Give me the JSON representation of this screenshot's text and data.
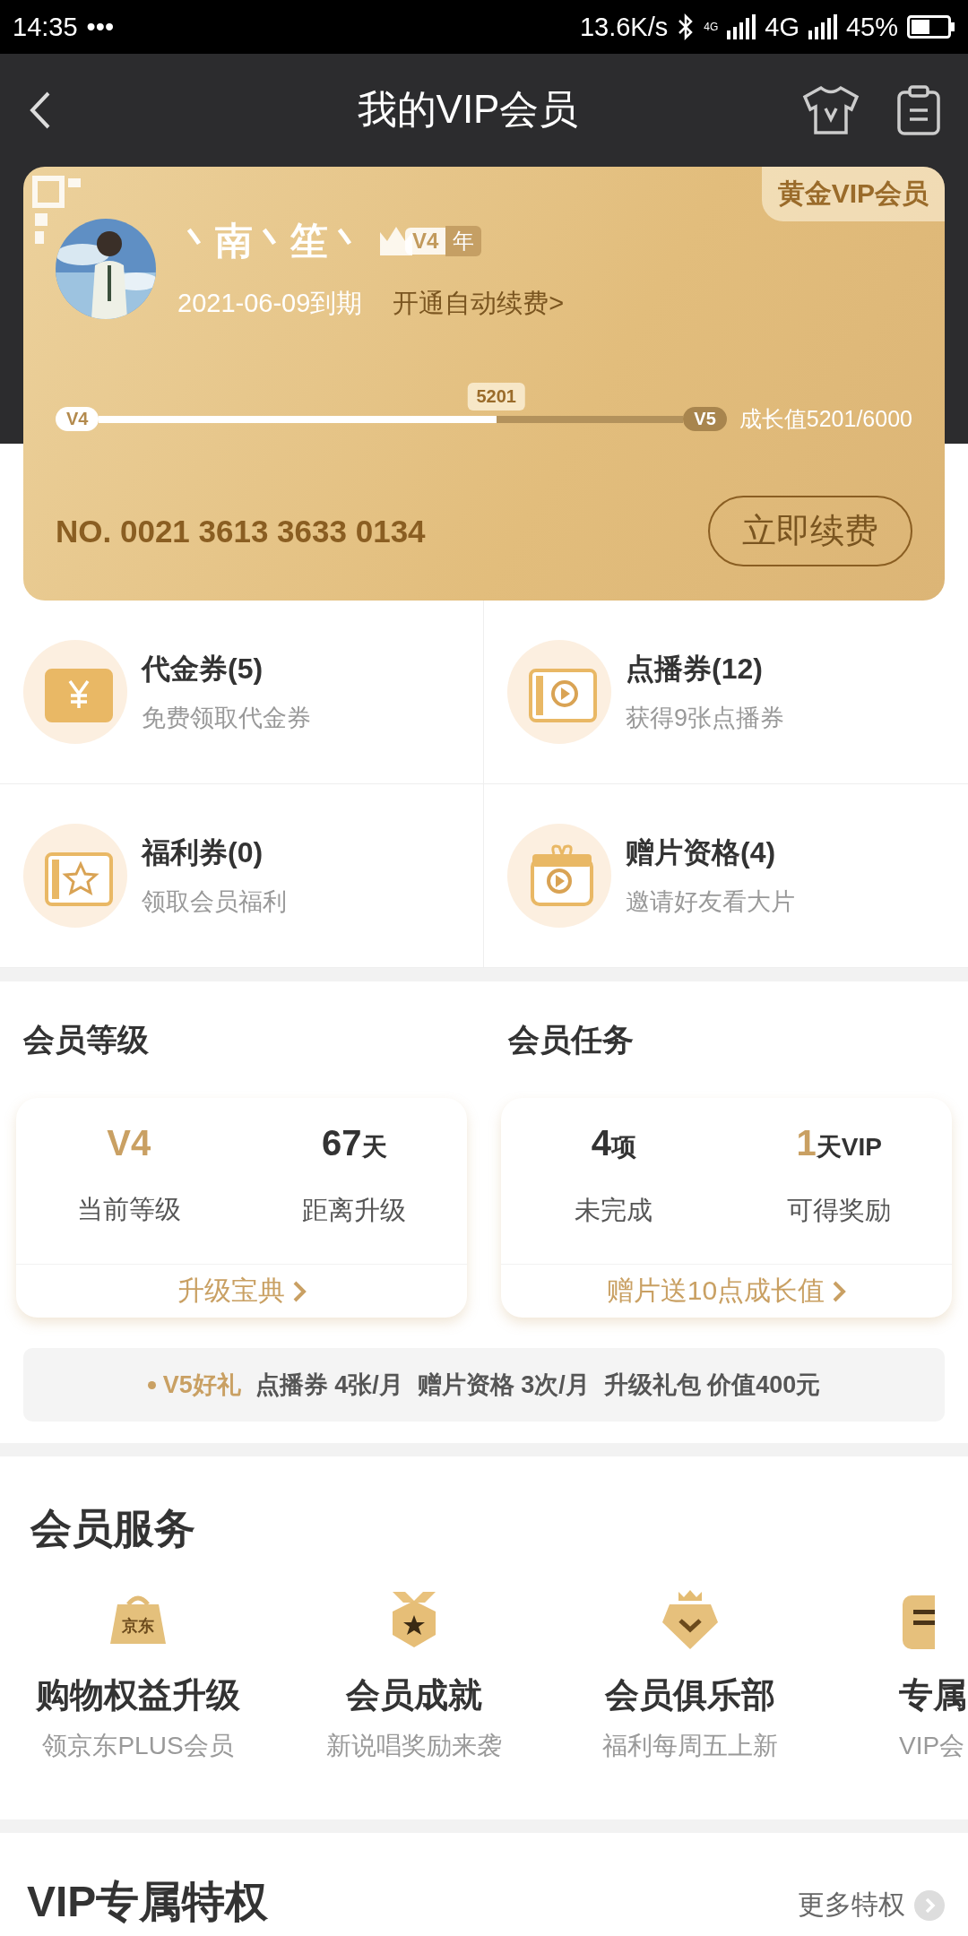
{
  "status_bar": {
    "time": "14:35",
    "dots": "•••",
    "speed": "13.6K/s",
    "network_small": "4G",
    "network": "4G",
    "battery": "45%"
  },
  "header": {
    "title": "我的VIP会员"
  },
  "card": {
    "badge": "黄金VIP会员",
    "username": "丶南丶笙丶",
    "level_tag": "V4",
    "year_tag": "年",
    "expiry": "2021-06-09到期",
    "auto_renew": "开通自动续费>",
    "progress": {
      "start": "V4",
      "end": "V5",
      "marker": "5201",
      "level": 0.68,
      "reading": "成长值5201/6000"
    },
    "number": "NO. 0021 3613 3633 0134",
    "renew_button": "立即续费"
  },
  "coupons": [
    {
      "kind": "yuan",
      "title": "代金券(5)",
      "subtitle": "免费领取代金券"
    },
    {
      "kind": "play",
      "title": "点播券(12)",
      "subtitle": "获得9张点播券"
    },
    {
      "kind": "star",
      "title": "福利券(0)",
      "subtitle": "领取会员福利"
    },
    {
      "kind": "gift",
      "title": "赠片资格(4)",
      "subtitle": "邀请好友看大片"
    }
  ],
  "panels": [
    {
      "title": "会员等级",
      "stats": [
        {
          "value": "V4",
          "highlight": true,
          "label": "当前等级"
        },
        {
          "value": "67",
          "unit": "天",
          "highlight": false,
          "label": "距离升级"
        }
      ],
      "link": "升级宝典"
    },
    {
      "title": "会员任务",
      "stats": [
        {
          "value": "4",
          "unit": "项",
          "highlight": false,
          "label": "未完成"
        },
        {
          "value": "1",
          "unit": "天VIP",
          "highlight": true,
          "label": "可得奖励"
        }
      ],
      "link": "赠片送10点成长值"
    }
  ],
  "v5_bar": {
    "title": "V5好礼",
    "items": [
      "点播券 4张/月",
      "赠片资格 3次/月",
      "升级礼包 价值400元"
    ]
  },
  "services": {
    "title": "会员服务",
    "items": [
      {
        "kind": "bag",
        "icon_text": "京东",
        "name": "购物权益升级",
        "subtitle": "领京东PLUS会员"
      },
      {
        "kind": "medal",
        "name": "会员成就",
        "subtitle": "新说唱奖励来袭"
      },
      {
        "kind": "diamond",
        "name": "会员俱乐部",
        "subtitle": "福利每周五上新"
      },
      {
        "kind": "doc",
        "name": "专属",
        "subtitle": "VIP会"
      }
    ]
  },
  "privileges": {
    "title": "VIP专属特权",
    "more": "更多特权"
  }
}
